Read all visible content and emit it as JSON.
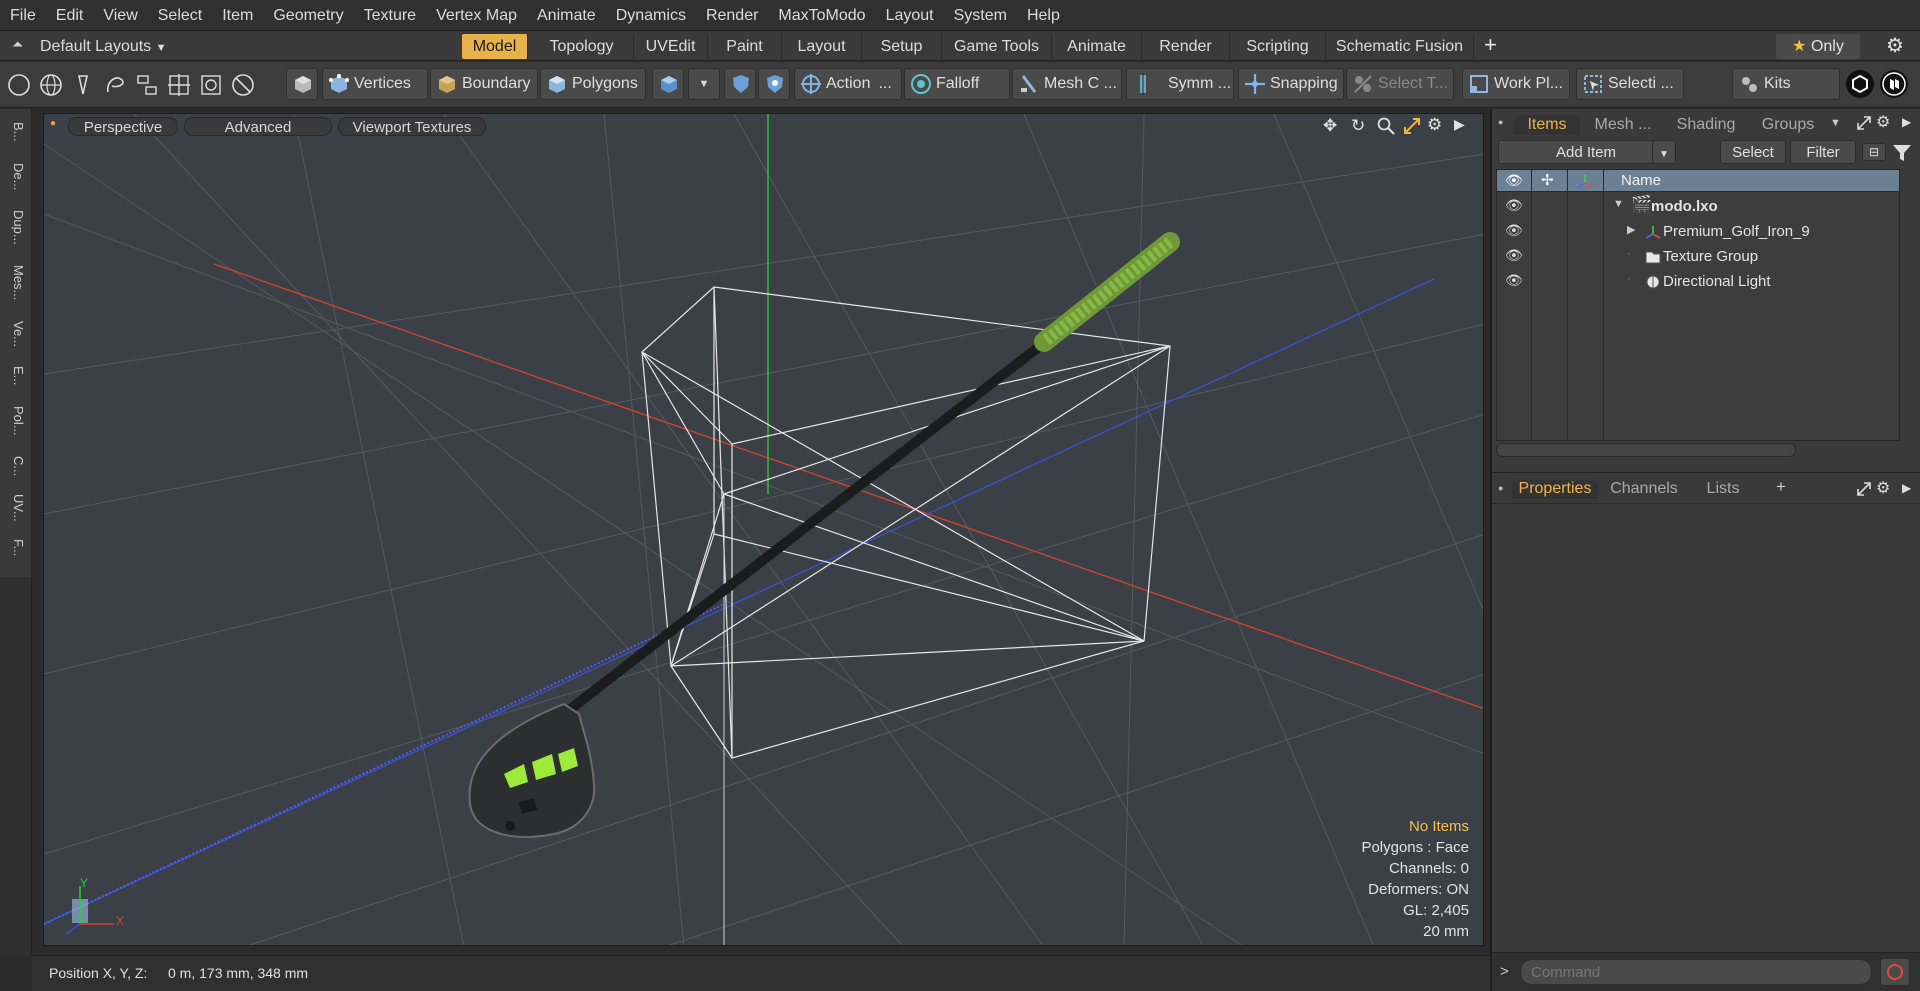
{
  "menu": [
    "File",
    "Edit",
    "View",
    "Select",
    "Item",
    "Geometry",
    "Texture",
    "Vertex Map",
    "Animate",
    "Dynamics",
    "Render",
    "MaxToModo",
    "Layout",
    "System",
    "Help"
  ],
  "layout_bar": {
    "layout_name": "Default Layouts",
    "tabs": [
      "Model",
      "Topology",
      "UVEdit",
      "Paint",
      "Layout",
      "Setup",
      "Game Tools",
      "Animate",
      "Render",
      "Scripting",
      "Schematic Fusion"
    ],
    "active_tab": "Model",
    "add_label": "+",
    "only_label": "Only"
  },
  "toolbar": {
    "vertices": "Vertices",
    "boundary": "Boundary",
    "polygons": "Polygons",
    "action": "Action",
    "action_more": "...",
    "falloff": "Falloff",
    "mesh_c": "Mesh C ...",
    "symm": "Symm ...",
    "snapping": "Snapping",
    "select_t": "Select T...",
    "work_pl": "Work Pl...",
    "selecti": "Selecti ...",
    "kits": "Kits"
  },
  "left_tabs": [
    "B...",
    "De...",
    "Dup...",
    "Mes...",
    "Ve...",
    "E...",
    "Pol...",
    "C...",
    "UV...",
    "F..."
  ],
  "viewport": {
    "perspective": "Perspective",
    "advanced": "Advanced",
    "viewport_textures": "Viewport Textures",
    "info": {
      "no_items": "No Items",
      "polygons": "Polygons : Face",
      "channels": "Channels: 0",
      "deformers": "Deformers: ON",
      "gl": "GL: 2,405",
      "scale": "20 mm"
    },
    "axis_x": "X",
    "axis_y": "Y"
  },
  "statusbar": {
    "position_label": "Position X, Y, Z:",
    "position_value": "0 m, 173 mm, 348 mm"
  },
  "items_panel": {
    "tabs": [
      "Items",
      "Mesh ...",
      "Shading",
      "Groups"
    ],
    "active_tab": "Items",
    "add_item": "Add Item",
    "select": "Select",
    "filter": "Filter",
    "name_header": "Name",
    "tree": [
      {
        "label": "modo.lxo",
        "bold": true
      },
      {
        "label": "Premium_Golf_Iron_9",
        "bold": false
      },
      {
        "label": "Texture Group",
        "bold": false
      },
      {
        "label": "Directional Light",
        "bold": false
      }
    ]
  },
  "props_panel": {
    "tabs": [
      "Properties",
      "Channels",
      "Lists"
    ],
    "active_tab": "Properties",
    "add_label": "+"
  },
  "command": {
    "placeholder": "Command"
  },
  "colors": {
    "accent": "#e8b24a",
    "viewport_bg": "#3b4046",
    "axis_red": "#d9412c",
    "axis_green": "#2ecc3a",
    "axis_blue": "#3b4fd6",
    "grip_green": "#7da83a"
  }
}
